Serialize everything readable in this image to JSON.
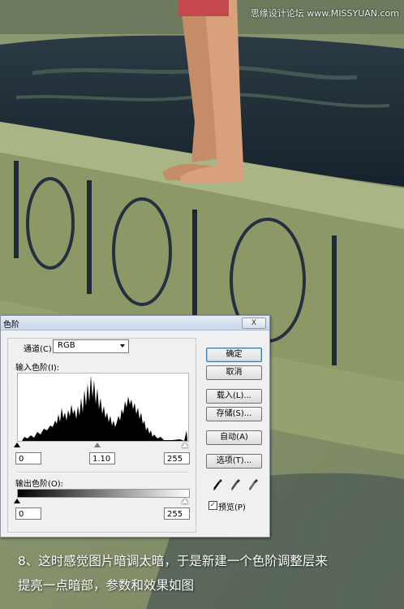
{
  "watermark": "思缘设计论坛 www.MISSYUAN.com",
  "caption": {
    "line1": "8、这时感觉图片暗调太暗，于是新建一个色阶调整层来",
    "line2": "提亮一点暗部，参数和效果如图"
  },
  "dialog": {
    "title": "色阶",
    "close": "X",
    "channel_label": "通道(C):",
    "channel_value": "RGB",
    "input_levels_label": "输入色阶(I):",
    "input_black": "0",
    "input_gamma": "1.10",
    "input_white": "255",
    "output_levels_label": "输出色阶(O):",
    "output_black": "0",
    "output_white": "255",
    "buttons": {
      "ok": "确定",
      "cancel": "取消",
      "load": "载入(L)...",
      "save": "存储(S)...",
      "auto": "自动(A)",
      "options": "选项(T)..."
    },
    "preview_label": "预览(P)",
    "preview_checked": true
  },
  "colors": {
    "water": "#1d2a35",
    "stone": "#9aa676",
    "skin": "#d9a07c"
  }
}
